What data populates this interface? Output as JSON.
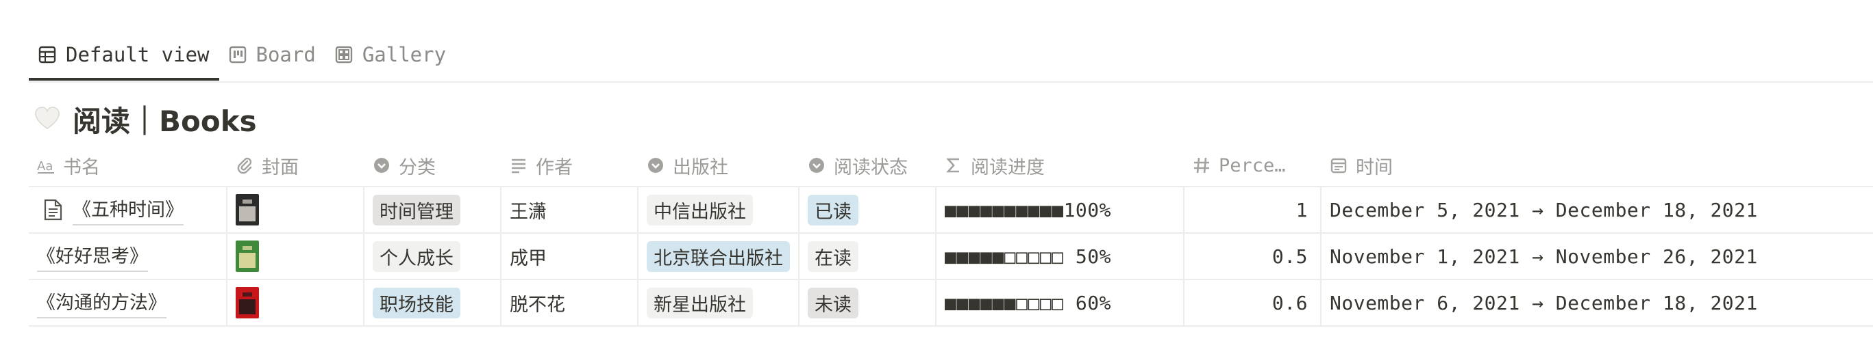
{
  "tabs": [
    {
      "label": "Default view",
      "icon": "table-icon",
      "active": true
    },
    {
      "label": "Board",
      "icon": "board-icon",
      "active": false
    },
    {
      "label": "Gallery",
      "icon": "gallery-icon",
      "active": false
    }
  ],
  "title": {
    "icon": "white-heart-icon",
    "text": "阅读｜Books"
  },
  "columns": [
    {
      "label": "书名",
      "icon": "title-aa-icon"
    },
    {
      "label": "封面",
      "icon": "attachment-icon"
    },
    {
      "label": "分类",
      "icon": "select-icon"
    },
    {
      "label": "作者",
      "icon": "text-lines-icon"
    },
    {
      "label": "出版社",
      "icon": "select-icon"
    },
    {
      "label": "阅读状态",
      "icon": "select-icon"
    },
    {
      "label": "阅读进度",
      "icon": "sigma-icon"
    },
    {
      "label": "Perce…",
      "icon": "hash-icon"
    },
    {
      "label": "时间",
      "icon": "calendar-icon"
    }
  ],
  "rows": [
    {
      "name": "《五种时间》",
      "has_page_icon": true,
      "category": "时间管理",
      "category_color": "#e3e2e0",
      "author": "王潇",
      "publisher": "中信出版社",
      "publisher_color": "#f1f1ef",
      "status": "已读",
      "status_color": "#d3e5ef",
      "progress": "■■■■■■■■■■100%",
      "percent": "1",
      "date": "December 5, 2021 → December 18, 2021",
      "cover_colors": [
        "#2b2b2b",
        "#d8d4cc"
      ]
    },
    {
      "name": "《好好思考》",
      "has_page_icon": false,
      "category": "个人成长",
      "category_color": "#f1f1ef",
      "author": "成甲",
      "publisher": "北京联合出版社",
      "publisher_color": "#d3e5ef",
      "status": "在读",
      "status_color": "#f1f1ef",
      "progress": "■■■■■□□□□□ 50%",
      "percent": "0.5",
      "date": "November 1, 2021 → November 26, 2021",
      "cover_colors": [
        "#3f8a3a",
        "#f2e2a8"
      ]
    },
    {
      "name": "《沟通的方法》",
      "has_page_icon": false,
      "category": "职场技能",
      "category_color": "#d3e5ef",
      "author": "脱不花",
      "publisher": "新星出版社",
      "publisher_color": "#f1f1ef",
      "status": "未读",
      "status_color": "#e3e2e0",
      "progress": "■■■■■■□□□□ 60%",
      "percent": "0.6",
      "date": "November 6, 2021 → December 18, 2021",
      "cover_colors": [
        "#c8171b",
        "#1a1a1a"
      ]
    }
  ]
}
